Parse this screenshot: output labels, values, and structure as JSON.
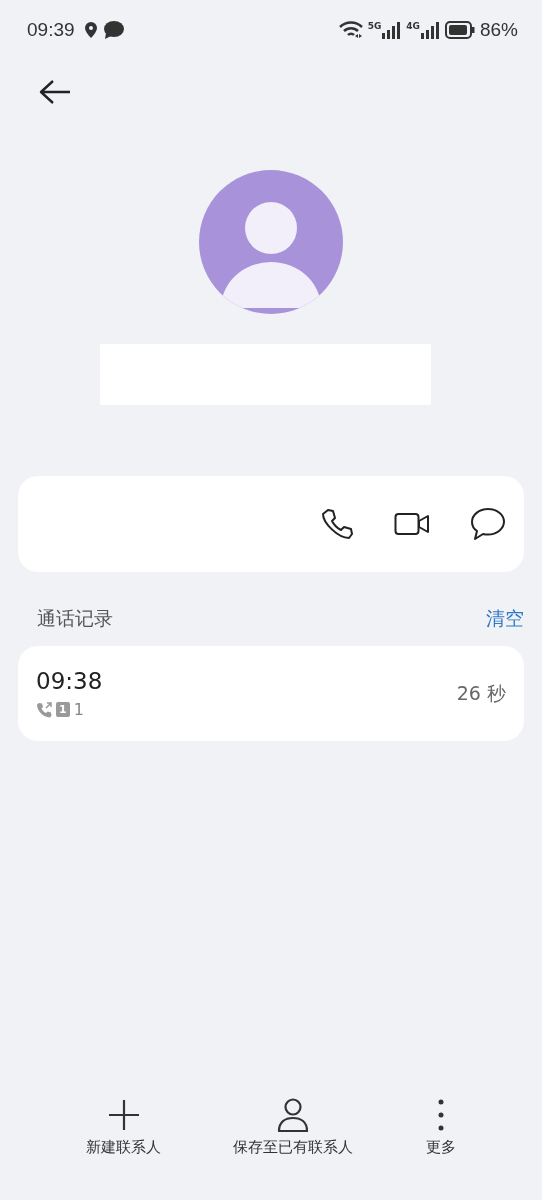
{
  "status_bar": {
    "time": "09:39",
    "battery_percent": "86%",
    "network_labels": [
      "5G",
      "4G"
    ]
  },
  "contact": {
    "actions": [
      {
        "kind": "call"
      },
      {
        "kind": "video"
      },
      {
        "kind": "message"
      }
    ]
  },
  "call_log": {
    "title": "通话记录",
    "clear_label": "清空",
    "entries": [
      {
        "time": "09:38",
        "sim": "1",
        "number": "1",
        "duration": "26 秒"
      }
    ]
  },
  "bottom_bar": [
    {
      "kind": "add",
      "label": "新建联系人"
    },
    {
      "kind": "person",
      "label": "保存至已有联系人"
    },
    {
      "kind": "more",
      "label": "更多"
    }
  ]
}
